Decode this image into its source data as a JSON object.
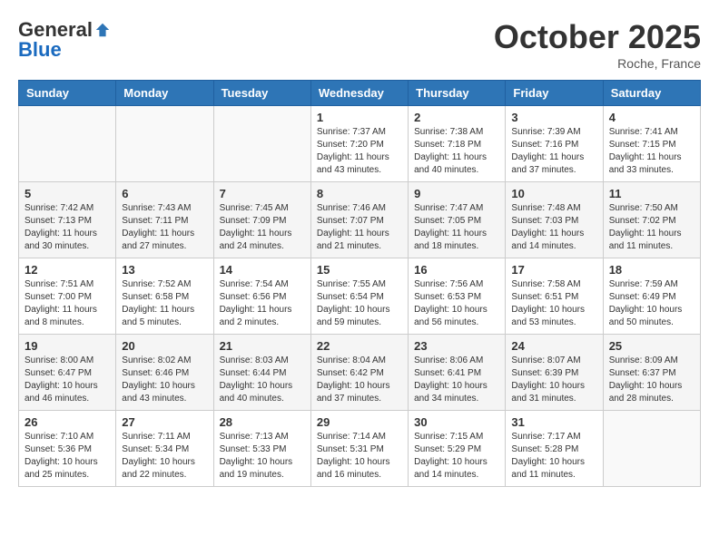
{
  "logo": {
    "general": "General",
    "blue": "Blue"
  },
  "header": {
    "month": "October 2025",
    "location": "Roche, France"
  },
  "days_of_week": [
    "Sunday",
    "Monday",
    "Tuesday",
    "Wednesday",
    "Thursday",
    "Friday",
    "Saturday"
  ],
  "weeks": [
    [
      {
        "day": "",
        "sunrise": "",
        "sunset": "",
        "daylight": ""
      },
      {
        "day": "",
        "sunrise": "",
        "sunset": "",
        "daylight": ""
      },
      {
        "day": "",
        "sunrise": "",
        "sunset": "",
        "daylight": ""
      },
      {
        "day": "1",
        "sunrise": "Sunrise: 7:37 AM",
        "sunset": "Sunset: 7:20 PM",
        "daylight": "Daylight: 11 hours and 43 minutes."
      },
      {
        "day": "2",
        "sunrise": "Sunrise: 7:38 AM",
        "sunset": "Sunset: 7:18 PM",
        "daylight": "Daylight: 11 hours and 40 minutes."
      },
      {
        "day": "3",
        "sunrise": "Sunrise: 7:39 AM",
        "sunset": "Sunset: 7:16 PM",
        "daylight": "Daylight: 11 hours and 37 minutes."
      },
      {
        "day": "4",
        "sunrise": "Sunrise: 7:41 AM",
        "sunset": "Sunset: 7:15 PM",
        "daylight": "Daylight: 11 hours and 33 minutes."
      }
    ],
    [
      {
        "day": "5",
        "sunrise": "Sunrise: 7:42 AM",
        "sunset": "Sunset: 7:13 PM",
        "daylight": "Daylight: 11 hours and 30 minutes."
      },
      {
        "day": "6",
        "sunrise": "Sunrise: 7:43 AM",
        "sunset": "Sunset: 7:11 PM",
        "daylight": "Daylight: 11 hours and 27 minutes."
      },
      {
        "day": "7",
        "sunrise": "Sunrise: 7:45 AM",
        "sunset": "Sunset: 7:09 PM",
        "daylight": "Daylight: 11 hours and 24 minutes."
      },
      {
        "day": "8",
        "sunrise": "Sunrise: 7:46 AM",
        "sunset": "Sunset: 7:07 PM",
        "daylight": "Daylight: 11 hours and 21 minutes."
      },
      {
        "day": "9",
        "sunrise": "Sunrise: 7:47 AM",
        "sunset": "Sunset: 7:05 PM",
        "daylight": "Daylight: 11 hours and 18 minutes."
      },
      {
        "day": "10",
        "sunrise": "Sunrise: 7:48 AM",
        "sunset": "Sunset: 7:03 PM",
        "daylight": "Daylight: 11 hours and 14 minutes."
      },
      {
        "day": "11",
        "sunrise": "Sunrise: 7:50 AM",
        "sunset": "Sunset: 7:02 PM",
        "daylight": "Daylight: 11 hours and 11 minutes."
      }
    ],
    [
      {
        "day": "12",
        "sunrise": "Sunrise: 7:51 AM",
        "sunset": "Sunset: 7:00 PM",
        "daylight": "Daylight: 11 hours and 8 minutes."
      },
      {
        "day": "13",
        "sunrise": "Sunrise: 7:52 AM",
        "sunset": "Sunset: 6:58 PM",
        "daylight": "Daylight: 11 hours and 5 minutes."
      },
      {
        "day": "14",
        "sunrise": "Sunrise: 7:54 AM",
        "sunset": "Sunset: 6:56 PM",
        "daylight": "Daylight: 11 hours and 2 minutes."
      },
      {
        "day": "15",
        "sunrise": "Sunrise: 7:55 AM",
        "sunset": "Sunset: 6:54 PM",
        "daylight": "Daylight: 10 hours and 59 minutes."
      },
      {
        "day": "16",
        "sunrise": "Sunrise: 7:56 AM",
        "sunset": "Sunset: 6:53 PM",
        "daylight": "Daylight: 10 hours and 56 minutes."
      },
      {
        "day": "17",
        "sunrise": "Sunrise: 7:58 AM",
        "sunset": "Sunset: 6:51 PM",
        "daylight": "Daylight: 10 hours and 53 minutes."
      },
      {
        "day": "18",
        "sunrise": "Sunrise: 7:59 AM",
        "sunset": "Sunset: 6:49 PM",
        "daylight": "Daylight: 10 hours and 50 minutes."
      }
    ],
    [
      {
        "day": "19",
        "sunrise": "Sunrise: 8:00 AM",
        "sunset": "Sunset: 6:47 PM",
        "daylight": "Daylight: 10 hours and 46 minutes."
      },
      {
        "day": "20",
        "sunrise": "Sunrise: 8:02 AM",
        "sunset": "Sunset: 6:46 PM",
        "daylight": "Daylight: 10 hours and 43 minutes."
      },
      {
        "day": "21",
        "sunrise": "Sunrise: 8:03 AM",
        "sunset": "Sunset: 6:44 PM",
        "daylight": "Daylight: 10 hours and 40 minutes."
      },
      {
        "day": "22",
        "sunrise": "Sunrise: 8:04 AM",
        "sunset": "Sunset: 6:42 PM",
        "daylight": "Daylight: 10 hours and 37 minutes."
      },
      {
        "day": "23",
        "sunrise": "Sunrise: 8:06 AM",
        "sunset": "Sunset: 6:41 PM",
        "daylight": "Daylight: 10 hours and 34 minutes."
      },
      {
        "day": "24",
        "sunrise": "Sunrise: 8:07 AM",
        "sunset": "Sunset: 6:39 PM",
        "daylight": "Daylight: 10 hours and 31 minutes."
      },
      {
        "day": "25",
        "sunrise": "Sunrise: 8:09 AM",
        "sunset": "Sunset: 6:37 PM",
        "daylight": "Daylight: 10 hours and 28 minutes."
      }
    ],
    [
      {
        "day": "26",
        "sunrise": "Sunrise: 7:10 AM",
        "sunset": "Sunset: 5:36 PM",
        "daylight": "Daylight: 10 hours and 25 minutes."
      },
      {
        "day": "27",
        "sunrise": "Sunrise: 7:11 AM",
        "sunset": "Sunset: 5:34 PM",
        "daylight": "Daylight: 10 hours and 22 minutes."
      },
      {
        "day": "28",
        "sunrise": "Sunrise: 7:13 AM",
        "sunset": "Sunset: 5:33 PM",
        "daylight": "Daylight: 10 hours and 19 minutes."
      },
      {
        "day": "29",
        "sunrise": "Sunrise: 7:14 AM",
        "sunset": "Sunset: 5:31 PM",
        "daylight": "Daylight: 10 hours and 16 minutes."
      },
      {
        "day": "30",
        "sunrise": "Sunrise: 7:15 AM",
        "sunset": "Sunset: 5:29 PM",
        "daylight": "Daylight: 10 hours and 14 minutes."
      },
      {
        "day": "31",
        "sunrise": "Sunrise: 7:17 AM",
        "sunset": "Sunset: 5:28 PM",
        "daylight": "Daylight: 10 hours and 11 minutes."
      },
      {
        "day": "",
        "sunrise": "",
        "sunset": "",
        "daylight": ""
      }
    ]
  ]
}
